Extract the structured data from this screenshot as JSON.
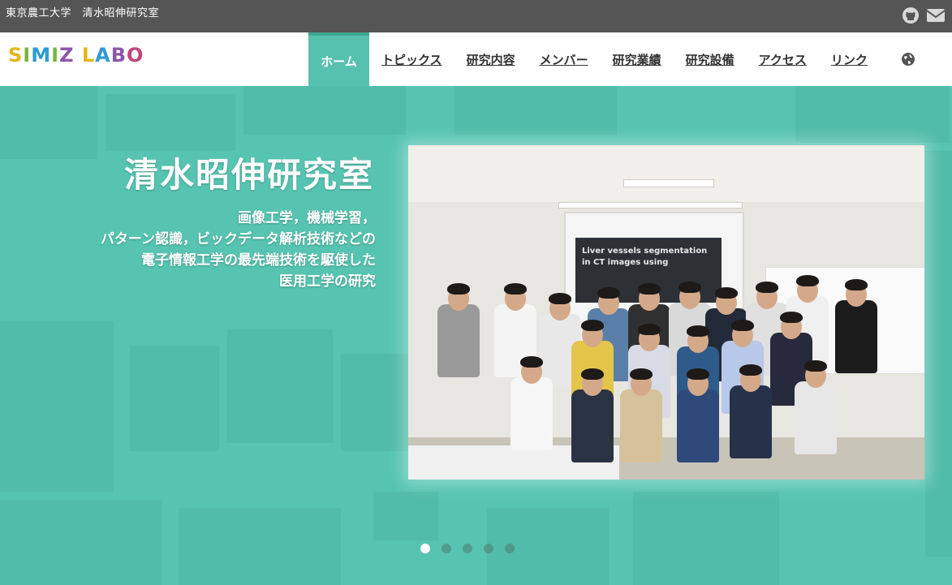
{
  "topbar": {
    "site_title": "東京農工大学　清水昭伸研究室",
    "icons": [
      "github-icon",
      "mail-icon"
    ]
  },
  "logo": {
    "letters": [
      {
        "ch": "S",
        "color": "#e3b51c"
      },
      {
        "ch": "I",
        "color": "#7cb342"
      },
      {
        "ch": "M",
        "color": "#2e9ad0"
      },
      {
        "ch": "I",
        "color": "#7cb342"
      },
      {
        "ch": "Z",
        "color": "#8c56a8"
      },
      {
        "ch": " ",
        "color": "#ffffff"
      },
      {
        "ch": "L",
        "color": "#e3b51c"
      },
      {
        "ch": "A",
        "color": "#2e9ad0"
      },
      {
        "ch": "B",
        "color": "#8c56a8"
      },
      {
        "ch": "O",
        "color": "#c0447a"
      }
    ]
  },
  "nav": {
    "items": [
      "ホーム",
      "トピックス",
      "研究内容",
      "メンバー",
      "研究業績",
      "研究設備",
      "アクセス",
      "リンク"
    ],
    "active_index": 0,
    "globe_icon": "globe-icon"
  },
  "hero": {
    "title": "清水昭伸研究室",
    "description_lines": [
      "画像工学，機械学習，",
      "パターン認識，ビックデータ解析技術などの",
      "電子情報工学の最先端技術を駆使した",
      "医用工学の研究"
    ],
    "slide_text": "Liver vessels segmentation in CT images using",
    "accent_color": "#57c1af"
  },
  "carousel": {
    "slide_count": 5,
    "active_index": 0
  }
}
